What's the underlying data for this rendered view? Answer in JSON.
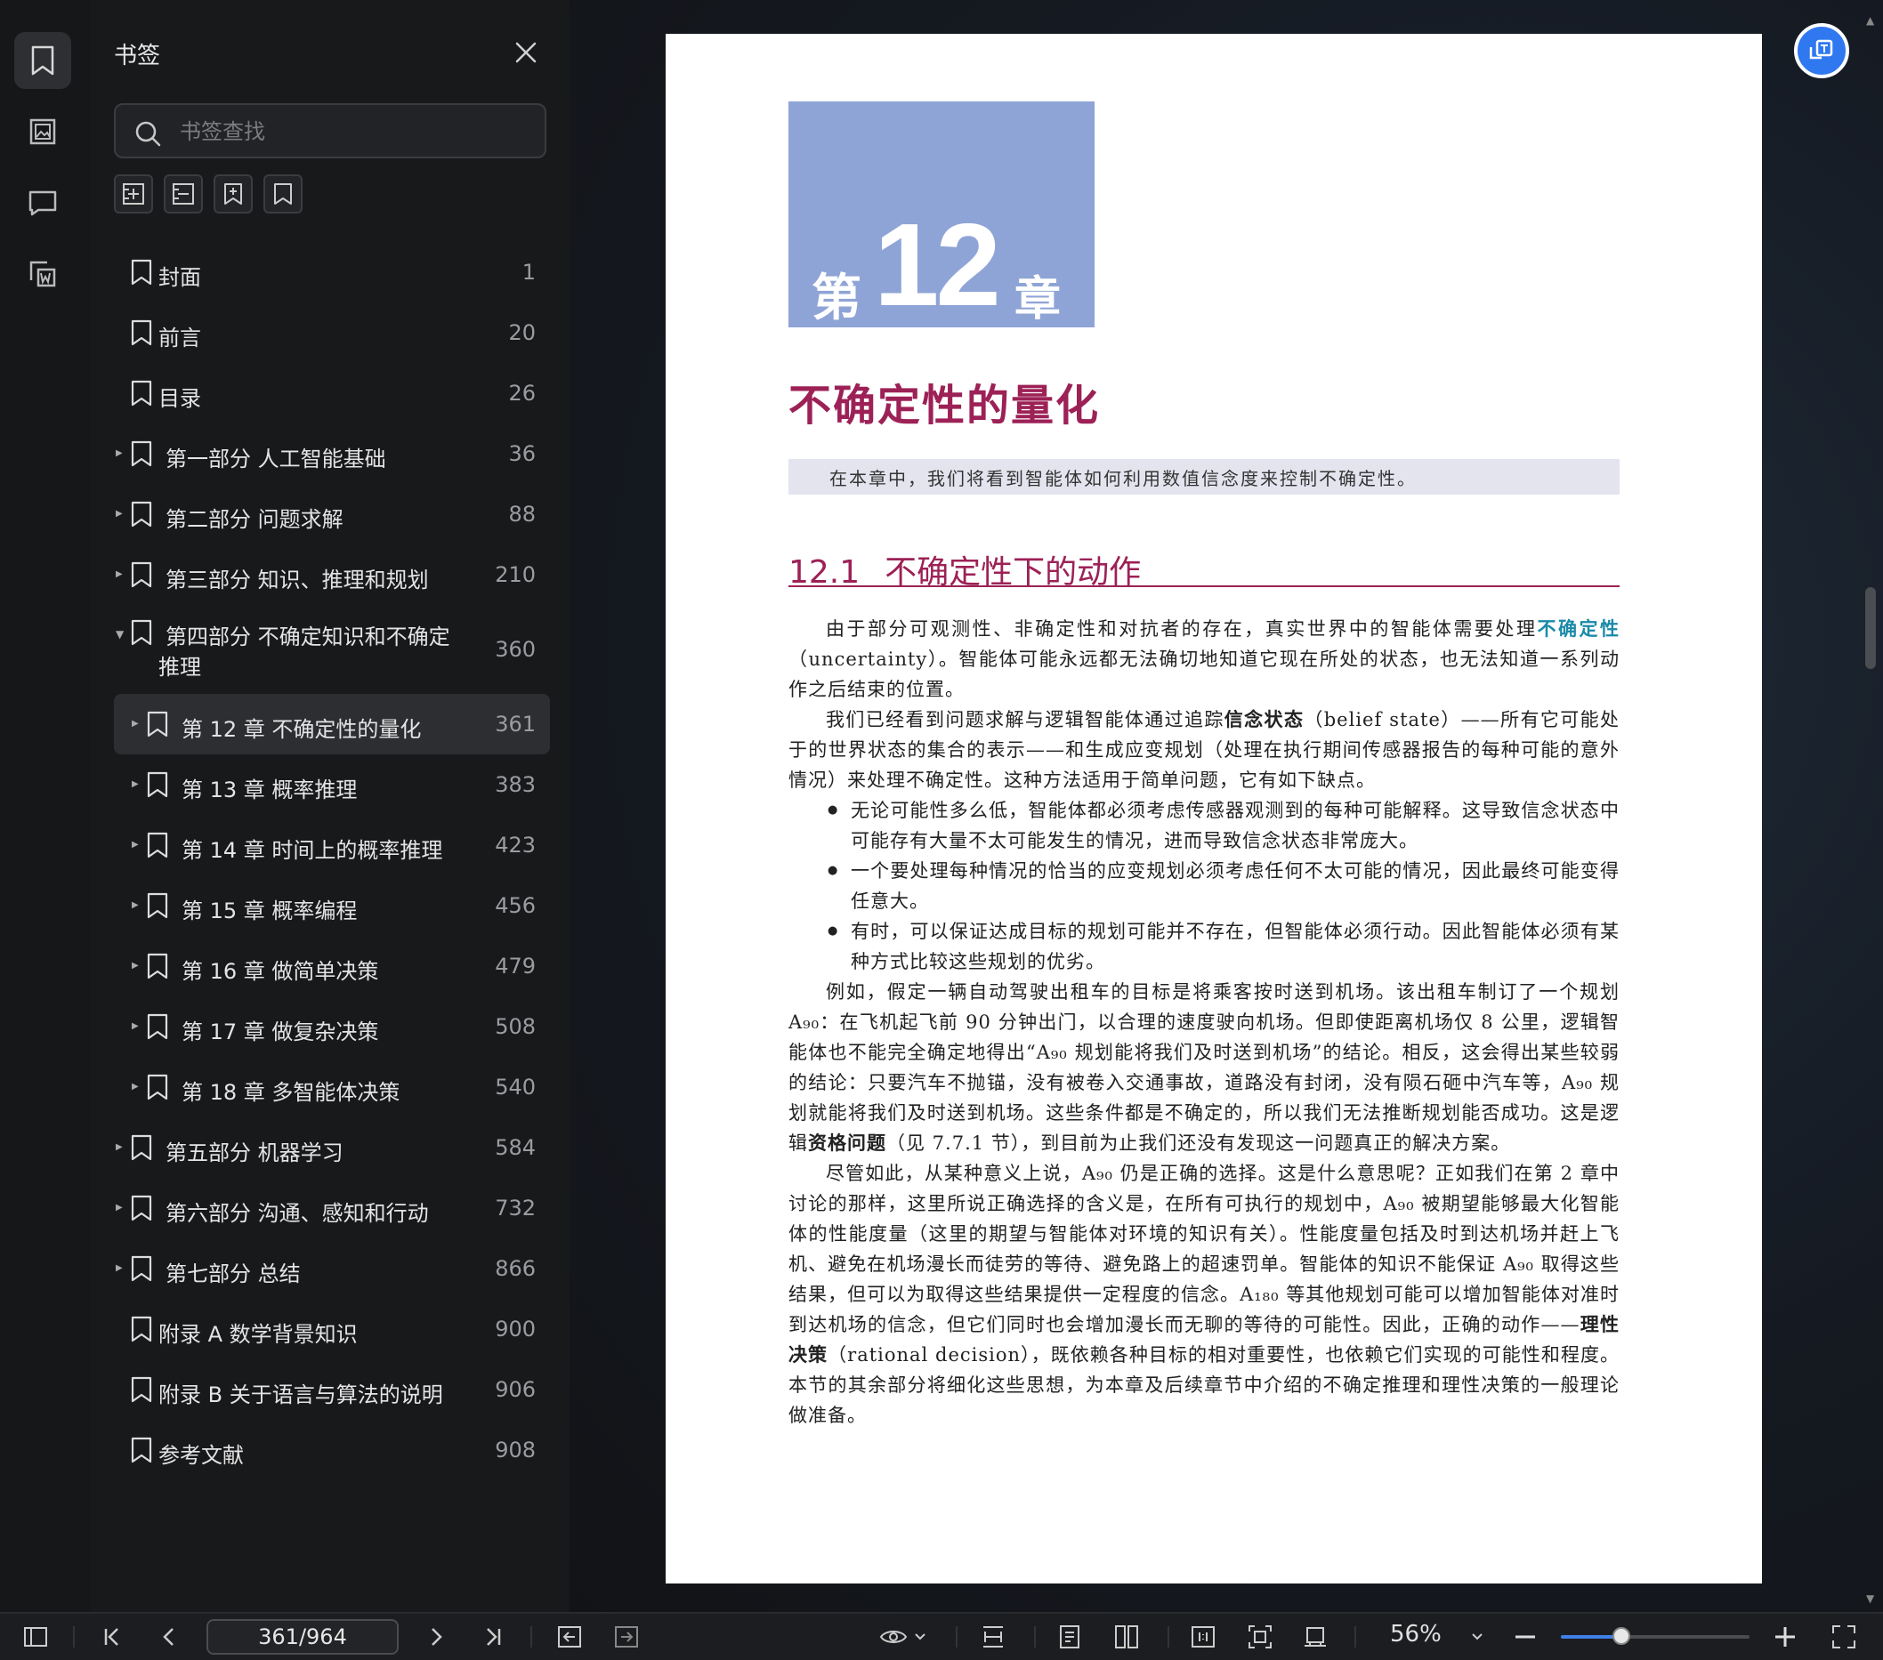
{
  "sidebar": {
    "title": "书签",
    "search_placeholder": "书签查找",
    "items": [
      {
        "label": "封面",
        "page": "1",
        "level": 0,
        "expander": "none"
      },
      {
        "label": "前言",
        "page": "20",
        "level": 0,
        "expander": "none"
      },
      {
        "label": "目录",
        "page": "26",
        "level": 0,
        "expander": "none"
      },
      {
        "label": "第一部分 人工智能基础",
        "page": "36",
        "level": 0,
        "expander": "collapsed"
      },
      {
        "label": "第二部分 问题求解",
        "page": "88",
        "level": 0,
        "expander": "collapsed"
      },
      {
        "label": "第三部分 知识、推理和规划",
        "page": "210",
        "level": 0,
        "expander": "collapsed"
      },
      {
        "label": "第四部分 不确定知识和不确定",
        "label2": "推理",
        "page": "360",
        "level": 0,
        "expander": "expanded"
      },
      {
        "label": "第 12 章 不确定性的量化",
        "page": "361",
        "level": 1,
        "expander": "collapsed",
        "selected": true
      },
      {
        "label": "第 13 章 概率推理",
        "page": "383",
        "level": 1,
        "expander": "collapsed"
      },
      {
        "label": "第 14 章 时间上的概率推理",
        "page": "423",
        "level": 1,
        "expander": "collapsed"
      },
      {
        "label": "第 15 章 概率编程",
        "page": "456",
        "level": 1,
        "expander": "collapsed"
      },
      {
        "label": "第 16 章 做简单决策",
        "page": "479",
        "level": 1,
        "expander": "collapsed"
      },
      {
        "label": "第 17 章 做复杂决策",
        "page": "508",
        "level": 1,
        "expander": "collapsed"
      },
      {
        "label": "第 18 章 多智能体决策",
        "page": "540",
        "level": 1,
        "expander": "collapsed"
      },
      {
        "label": "第五部分 机器学习",
        "page": "584",
        "level": 0,
        "expander": "collapsed"
      },
      {
        "label": "第六部分 沟通、感知和行动",
        "page": "732",
        "level": 0,
        "expander": "collapsed"
      },
      {
        "label": "第七部分 总结",
        "page": "866",
        "level": 0,
        "expander": "collapsed"
      },
      {
        "label": "附录 A 数学背景知识",
        "page": "900",
        "level": 0,
        "expander": "none"
      },
      {
        "label": "附录 B 关于语言与算法的说明",
        "page": "906",
        "level": 0,
        "expander": "none"
      },
      {
        "label": "参考文献",
        "page": "908",
        "level": 0,
        "expander": "none"
      }
    ]
  },
  "page": {
    "chap_prefix": "第",
    "chap_num": "12",
    "chap_suffix": "章",
    "chapter_title": "不确定性的量化",
    "intro": "在本章中，我们将看到智能体如何利用数值信念度来控制不确定性。",
    "section_num": "12.1",
    "section_title": "不确定性下的动作",
    "p1a": "由于部分可观测性、非确定性和对抗者的存在，真实世界中的智能体需要处理",
    "p1_term": "不确定性",
    "p1b": "（uncertainty）。智能体可能永远都无法确切地知道它现在所处的状态，也无法知道一系列动作之后结束的位置。",
    "p2a": "我们已经看到问题求解与逻辑智能体通过追踪",
    "p2_term": "信念状态",
    "p2b": "（belief state）——所有它可能处于的世界状态的集合的表示——和生成应变规划（处理在执行期间传感器报告的每种可能的意外情况）来处理不确定性。这种方法适用于简单问题，它有如下缺点。",
    "bullets": [
      "无论可能性多么低，智能体都必须考虑传感器观测到的每种可能解释。这导致信念状态中可能存有大量不太可能发生的情况，进而导致信念状态非常庞大。",
      "一个要处理每种情况的恰当的应变规划必须考虑任何不太可能的情况，因此最终可能变得任意大。",
      "有时，可以保证达成目标的规划可能并不存在，但智能体必须行动。因此智能体必须有某种方式比较这些规划的优劣。"
    ],
    "p3a": "例如，假定一辆自动驾驶出租车的目标是将乘客按时送到机场。该出租车制订了一个规划 A₉₀：在飞机起飞前 90 分钟出门，以合理的速度驶向机场。但即使距离机场仅 8 公里，逻辑智能体也不能完全确定地得出“A₉₀ 规划能将我们及时送到机场”的结论。相反，这会得出某些较弱的结论：只要汽车不抛锚，没有被卷入交通事故，道路没有封闭，没有陨石砸中汽车等，A₉₀ 规划就能将我们及时送到机场。这些条件都是不确定的，所以我们无法推断规划能否成功。这是逻辑",
    "p3_term": "资格问题",
    "p3b": "（见 7.7.1 节），到目前为止我们还没有发现这一问题真正的解决方案。",
    "p4a": "尽管如此，从某种意义上说，A₉₀ 仍是正确的选择。这是什么意思呢？正如我们在第 2 章中讨论的那样，这里所说正确选择的含义是，在所有可执行的规划中，A₉₀ 被期望能够最大化智能体的性能度量（这里的期望与智能体对环境的知识有关）。性能度量包括及时到达机场并赶上飞机、避免在机场漫长而徒劳的等待、避免路上的超速罚单。智能体的知识不能保证 A₉₀ 取得这些结果，但可以为取得这些结果提供一定程度的信念。A₁₈₀ 等其他规划可能可以增加智能体对准时到达机场的信念，但它们同时也会增加漫长而无聊的等待的可能性。因此，正确的动作——",
    "p4_term": "理性决策",
    "p4b": "（rational decision），既依赖各种目标的相对重要性，也依赖它们实现的可能性和程度。本节的其余部分将细化这些思想，为本章及后续章节中介绍的不确定推理和理性决策的一般理论做准备。"
  },
  "toolbar": {
    "page_indicator": "361/964",
    "zoom": "56%",
    "zoom_fraction": 0.32
  }
}
